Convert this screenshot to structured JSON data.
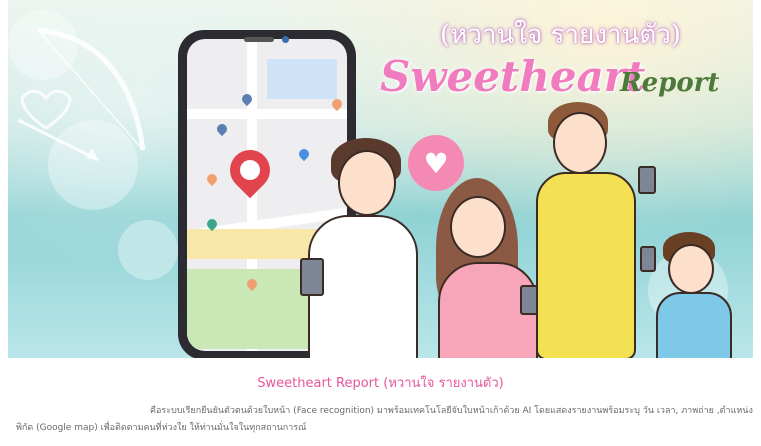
{
  "banner": {
    "subtitle": "(หวานใจ รายงานตัว)",
    "title_main": "Sweetheart",
    "title_report": "Report"
  },
  "content": {
    "heading": "Sweetheart Report (หวานใจ รายงานตัว)",
    "description_line1": "คือระบบเรียกยืนยันตัวตนด้วยใบหน้า (Face recognition) มาพร้อมเทคโนโลยีจับใบหน้าเก้าด้วย AI โดยแสดงรายงานพร้อมระบุ วัน เวลา, ภาพถ่าย ,ตำแหน่ง",
    "description_line2": "พิกัด (Google map) เพื่อติดตามคนที่ห่วงใย ให้ท่านมั่นใจในทุกสถานการณ์"
  },
  "colors": {
    "accent_pink": "#e6569a",
    "title_pink": "#f07cbf",
    "report_green": "#4b7a3a",
    "pin_red": "#e2444e"
  }
}
